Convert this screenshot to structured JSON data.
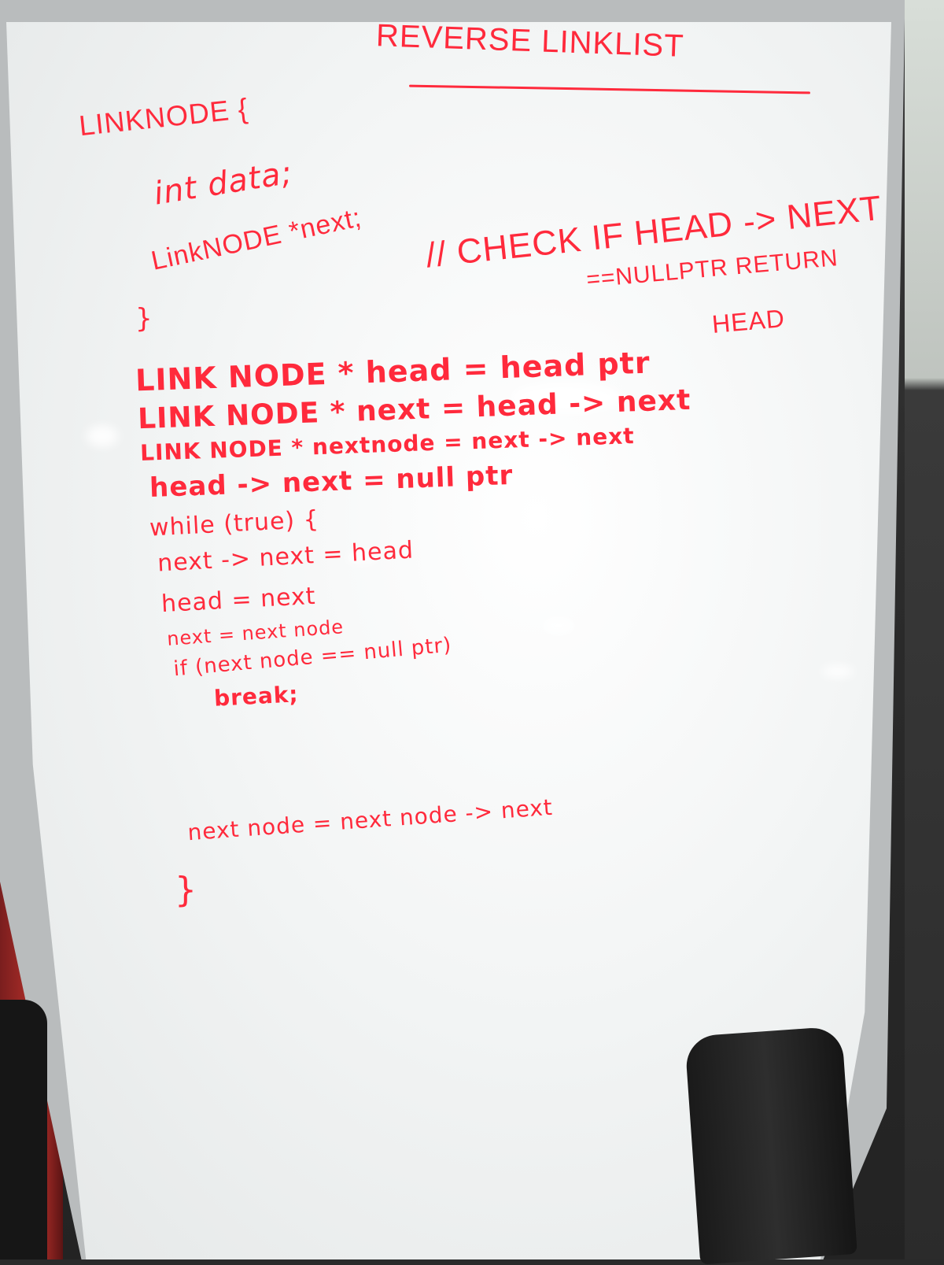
{
  "whiteboard": {
    "title": "REVERSE LINKLIST",
    "struct_lines": [
      "LINKNODE {",
      "int data;",
      "LinkNODE *next;",
      "}"
    ],
    "comment": {
      "line1": "// CHECK IF HEAD -> NEXT",
      "line2": "==NULLPTR RETURN",
      "line3": "HEAD"
    },
    "code_lines": [
      "LINK NODE * head = head ptr",
      "LINK NODE * next = head -> next",
      "LINK NODE * nextnode = next -> next",
      "head -> next = null ptr",
      "while (true) {",
      "next -> next = head",
      "head = next",
      "next = next node",
      "if (next node == null ptr)",
      "break;",
      "next node = next node -> next",
      "}"
    ]
  },
  "ink_color": "#ff2a3c"
}
